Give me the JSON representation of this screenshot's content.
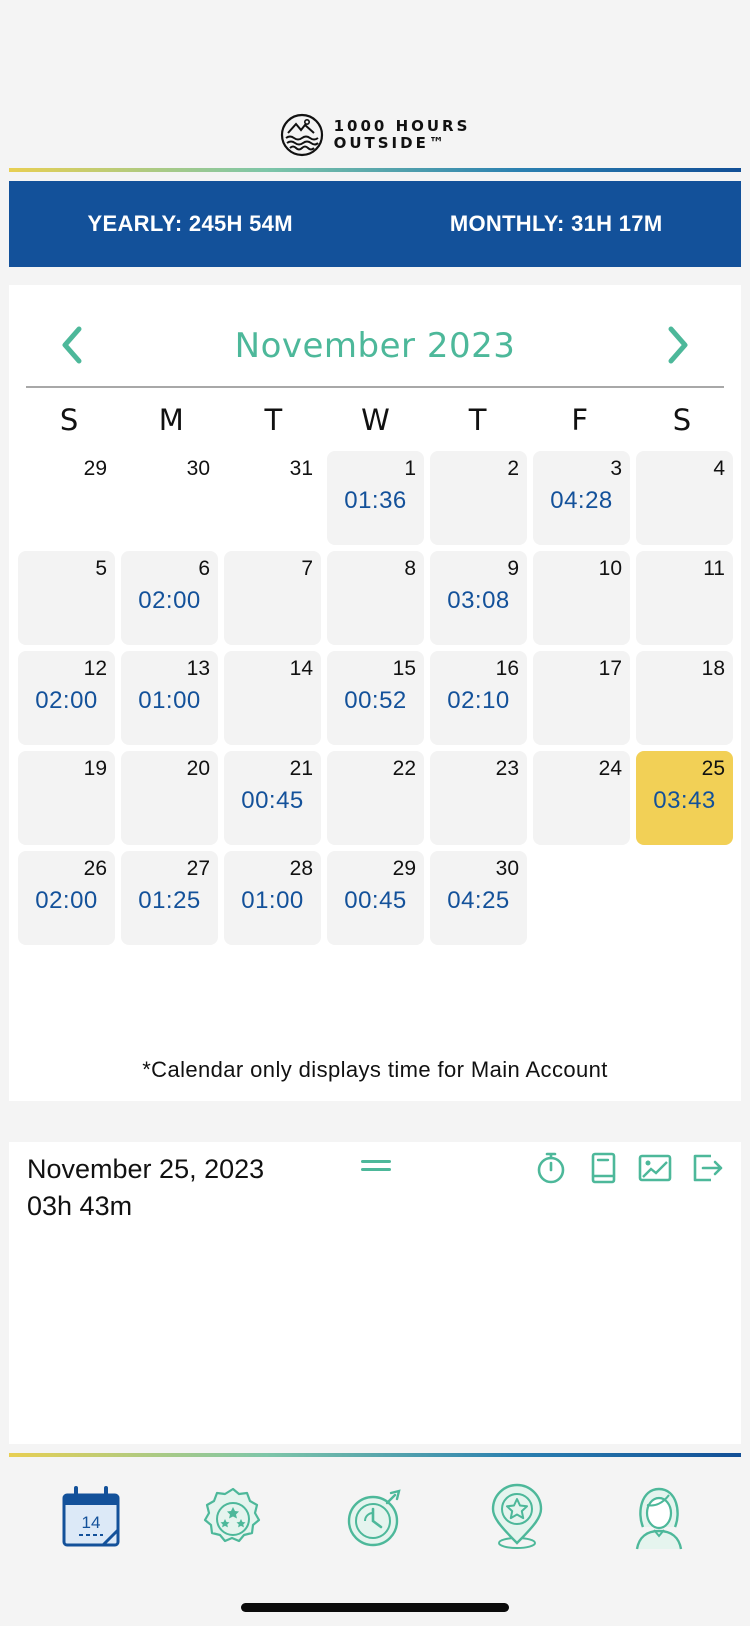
{
  "brand": {
    "line1": "1000 HOURS",
    "line2": "OUTSIDE™"
  },
  "totals": {
    "yearly": "YEARLY: 245H 54M",
    "monthly": "MONTHLY: 31H 17M"
  },
  "calendar": {
    "month_title": "November 2023",
    "weekdays": [
      "S",
      "M",
      "T",
      "W",
      "T",
      "F",
      "S"
    ],
    "cells": [
      {
        "day": "29",
        "hours": "",
        "kind": "other"
      },
      {
        "day": "30",
        "hours": "",
        "kind": "other"
      },
      {
        "day": "31",
        "hours": "",
        "kind": "other"
      },
      {
        "day": "1",
        "hours": "01:36",
        "kind": "day"
      },
      {
        "day": "2",
        "hours": "",
        "kind": "day"
      },
      {
        "day": "3",
        "hours": "04:28",
        "kind": "day"
      },
      {
        "day": "4",
        "hours": "",
        "kind": "day"
      },
      {
        "day": "5",
        "hours": "",
        "kind": "day"
      },
      {
        "day": "6",
        "hours": "02:00",
        "kind": "day"
      },
      {
        "day": "7",
        "hours": "",
        "kind": "day"
      },
      {
        "day": "8",
        "hours": "",
        "kind": "day"
      },
      {
        "day": "9",
        "hours": "03:08",
        "kind": "day"
      },
      {
        "day": "10",
        "hours": "",
        "kind": "day"
      },
      {
        "day": "11",
        "hours": "",
        "kind": "day"
      },
      {
        "day": "12",
        "hours": "02:00",
        "kind": "day"
      },
      {
        "day": "13",
        "hours": "01:00",
        "kind": "day"
      },
      {
        "day": "14",
        "hours": "",
        "kind": "day"
      },
      {
        "day": "15",
        "hours": "00:52",
        "kind": "day"
      },
      {
        "day": "16",
        "hours": "02:10",
        "kind": "day"
      },
      {
        "day": "17",
        "hours": "",
        "kind": "day"
      },
      {
        "day": "18",
        "hours": "",
        "kind": "day"
      },
      {
        "day": "19",
        "hours": "",
        "kind": "day"
      },
      {
        "day": "20",
        "hours": "",
        "kind": "day"
      },
      {
        "day": "21",
        "hours": "00:45",
        "kind": "day"
      },
      {
        "day": "22",
        "hours": "",
        "kind": "day"
      },
      {
        "day": "23",
        "hours": "",
        "kind": "day"
      },
      {
        "day": "24",
        "hours": "",
        "kind": "day"
      },
      {
        "day": "25",
        "hours": "03:43",
        "kind": "selected"
      },
      {
        "day": "26",
        "hours": "02:00",
        "kind": "day"
      },
      {
        "day": "27",
        "hours": "01:25",
        "kind": "day"
      },
      {
        "day": "28",
        "hours": "01:00",
        "kind": "day"
      },
      {
        "day": "29",
        "hours": "00:45",
        "kind": "day"
      },
      {
        "day": "30",
        "hours": "04:25",
        "kind": "day"
      },
      {
        "day": "",
        "hours": "",
        "kind": "empty"
      },
      {
        "day": "",
        "hours": "",
        "kind": "empty"
      }
    ],
    "note": "*Calendar only displays time for Main Account"
  },
  "detail": {
    "date": "November 25, 2023",
    "hours": "03h 43m",
    "actions": [
      "timer-icon",
      "journal-icon",
      "photo-icon",
      "export-icon"
    ]
  },
  "tabs": [
    {
      "name": "calendar",
      "icon": "calendar-icon",
      "badge": "14"
    },
    {
      "name": "badges",
      "icon": "badge-stars-icon"
    },
    {
      "name": "timer",
      "icon": "stopwatch-icon"
    },
    {
      "name": "places",
      "icon": "location-star-icon"
    },
    {
      "name": "profile",
      "icon": "profile-avatar-icon"
    }
  ],
  "colors": {
    "accent": "#4db89a",
    "brand_blue": "#13519a",
    "selected": "#f2d056",
    "cell_bg": "#f3f3f3"
  }
}
